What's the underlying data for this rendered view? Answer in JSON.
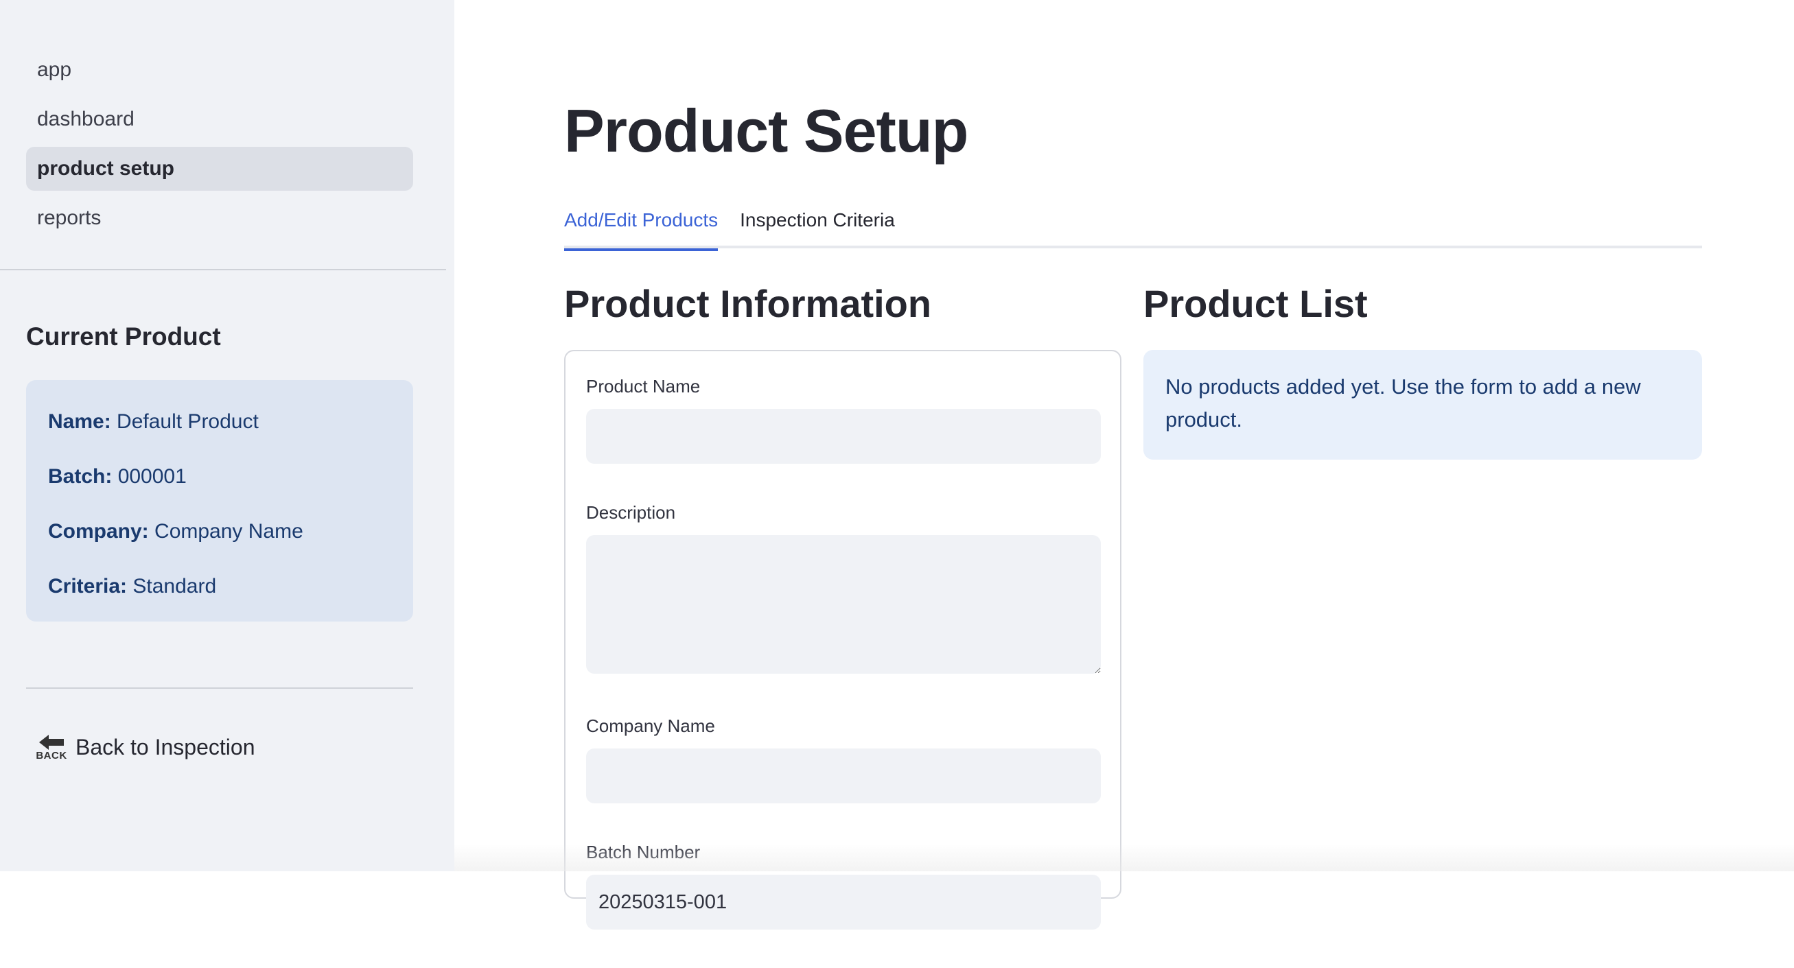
{
  "sidebar": {
    "nav_items": [
      {
        "label": "app",
        "active": false
      },
      {
        "label": "dashboard",
        "active": false
      },
      {
        "label": "product setup",
        "active": true
      },
      {
        "label": "reports",
        "active": false
      }
    ],
    "current_product": {
      "title": "Current Product",
      "name_label": "Name:",
      "name_value": "Default Product",
      "batch_label": "Batch:",
      "batch_value": "000001",
      "company_label": "Company:",
      "company_value": "Company Name",
      "criteria_label": "Criteria:",
      "criteria_value": "Standard"
    },
    "back_icon_text": "BACK",
    "back_label": "Back to Inspection"
  },
  "main": {
    "title": "Product Setup",
    "tabs": [
      {
        "label": "Add/Edit Products",
        "active": true
      },
      {
        "label": "Inspection Criteria",
        "active": false
      }
    ],
    "product_information": {
      "title": "Product Information",
      "fields": {
        "product_name": {
          "label": "Product Name",
          "value": ""
        },
        "description": {
          "label": "Description",
          "value": ""
        },
        "company_name": {
          "label": "Company Name",
          "value": ""
        },
        "batch_number": {
          "label": "Batch Number",
          "value": "20250315-001"
        }
      }
    },
    "product_list": {
      "title": "Product List",
      "empty_message": "No products added yet. Use the form to add a new product."
    }
  },
  "colors": {
    "accent": "#3b63d6",
    "sidebar_bg": "#f0f2f6",
    "info_bg": "#e8f0fb",
    "info_text": "#1a3a6e"
  }
}
